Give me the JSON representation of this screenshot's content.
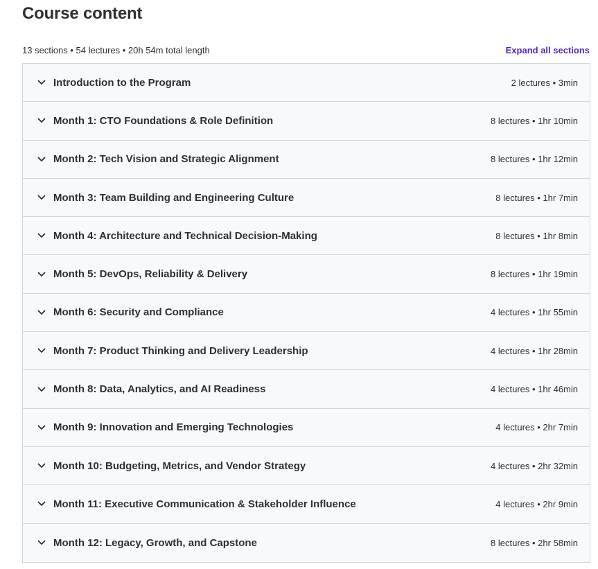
{
  "header": {
    "title": "Course content",
    "summary": "13 sections • 54 lectures • 20h 54m total length",
    "expand_all_label": "Expand all sections"
  },
  "colors": {
    "accent": "#5624d0",
    "section_bg": "#f7f9fa",
    "border": "#d1d7dc",
    "text": "#2d2f31"
  },
  "sections": [
    {
      "title": "Introduction to the Program",
      "meta": "2 lectures • 3min",
      "icon": "chevron-down-icon"
    },
    {
      "title": "Month 1: CTO Foundations & Role Definition",
      "meta": "8 lectures • 1hr 10min",
      "icon": "chevron-down-icon"
    },
    {
      "title": "Month 2: Tech Vision and Strategic Alignment",
      "meta": "8 lectures • 1hr 12min",
      "icon": "chevron-down-icon"
    },
    {
      "title": "Month 3: Team Building and Engineering Culture",
      "meta": "8 lectures • 1hr 7min",
      "icon": "chevron-down-icon"
    },
    {
      "title": "Month 4: Architecture and Technical Decision-Making",
      "meta": "8 lectures • 1hr 8min",
      "icon": "chevron-down-icon"
    },
    {
      "title": "Month 5: DevOps, Reliability & Delivery",
      "meta": "8 lectures • 1hr 19min",
      "icon": "chevron-down-icon"
    },
    {
      "title": "Month 6: Security and Compliance",
      "meta": "4 lectures • 1hr 55min",
      "icon": "chevron-down-icon"
    },
    {
      "title": "Month 7: Product Thinking and Delivery Leadership",
      "meta": "4 lectures • 1hr 28min",
      "icon": "chevron-down-icon"
    },
    {
      "title": "Month 8: Data, Analytics, and AI Readiness",
      "meta": "4 lectures • 1hr 46min",
      "icon": "chevron-down-icon"
    },
    {
      "title": "Month 9: Innovation and Emerging Technologies",
      "meta": "4 lectures • 2hr 7min",
      "icon": "chevron-down-icon"
    },
    {
      "title": "Month 10: Budgeting, Metrics, and Vendor Strategy",
      "meta": "4 lectures • 2hr 32min",
      "icon": "chevron-down-icon"
    },
    {
      "title": "Month 11: Executive Communication & Stakeholder Influence",
      "meta": "4 lectures • 2hr 9min",
      "icon": "chevron-down-icon"
    },
    {
      "title": "Month 12: Legacy, Growth, and Capstone",
      "meta": "8 lectures • 2hr 58min",
      "icon": "chevron-down-icon"
    }
  ]
}
